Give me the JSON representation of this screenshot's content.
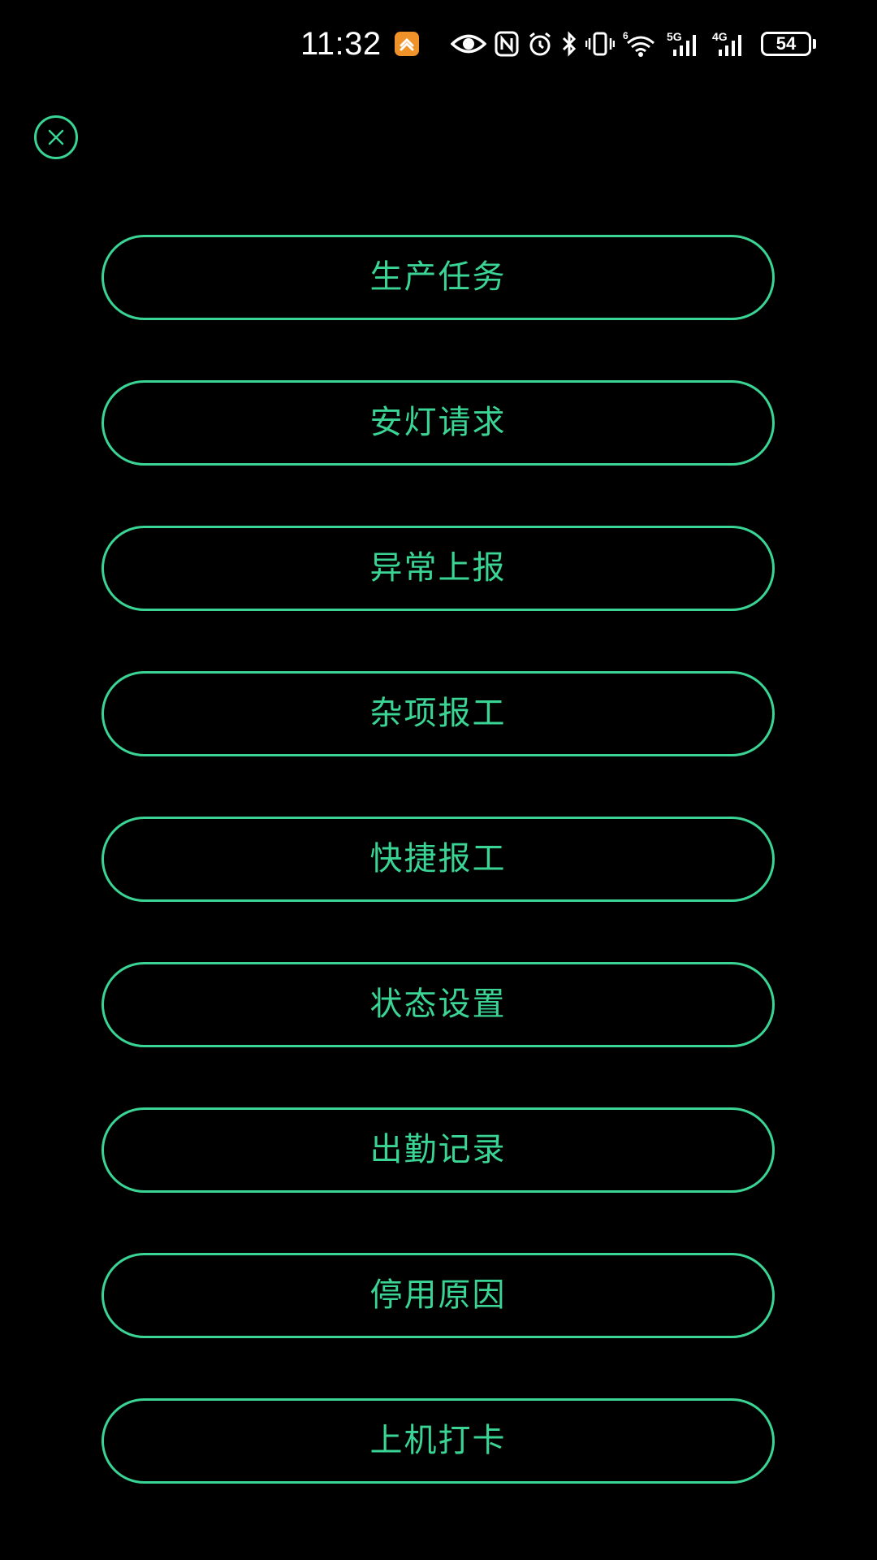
{
  "status_bar": {
    "time": "11:32",
    "battery_level": "54",
    "wifi_badge": "6",
    "network_1": "5G",
    "network_2": "4G",
    "icons": [
      "app-badge-icon",
      "eye-icon",
      "nfc-icon",
      "alarm-icon",
      "bluetooth-icon",
      "vibrate-icon",
      "wifi-icon",
      "signal-5g-icon",
      "signal-4g-icon",
      "battery-icon"
    ]
  },
  "close_icon": "close-icon",
  "menu": {
    "items": [
      {
        "label": "生产任务"
      },
      {
        "label": "安灯请求"
      },
      {
        "label": "异常上报"
      },
      {
        "label": "杂项报工"
      },
      {
        "label": "快捷报工"
      },
      {
        "label": "状态设置"
      },
      {
        "label": "出勤记录"
      },
      {
        "label": "停用原因"
      },
      {
        "label": "上机打卡"
      }
    ]
  },
  "colors": {
    "background": "#000000",
    "accent": "#3ad494",
    "status_text": "#ffffff",
    "app_badge": "#f0922a"
  }
}
